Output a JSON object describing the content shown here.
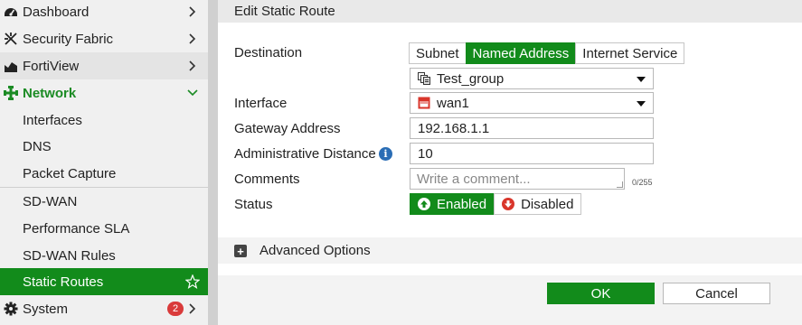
{
  "sidebar": {
    "items": [
      {
        "label": "Dashboard",
        "icon": "dashboard-icon"
      },
      {
        "label": "Security Fabric",
        "icon": "security-fabric-icon"
      },
      {
        "label": "FortiView",
        "icon": "fortiview-icon"
      },
      {
        "label": "Network",
        "icon": "network-icon"
      },
      {
        "label": "Interfaces"
      },
      {
        "label": "DNS"
      },
      {
        "label": "Packet Capture"
      },
      {
        "label": "SD-WAN"
      },
      {
        "label": "Performance SLA"
      },
      {
        "label": "SD-WAN Rules"
      },
      {
        "label": "Static Routes"
      },
      {
        "label": "System",
        "icon": "gear-icon",
        "badge": "2"
      }
    ]
  },
  "dialog": {
    "title": "Edit Static Route",
    "destination": {
      "label": "Destination",
      "options": [
        "Subnet",
        "Named Address",
        "Internet Service"
      ],
      "selected": "Named Address",
      "address_value": "Test_group"
    },
    "interface": {
      "label": "Interface",
      "value": "wan1"
    },
    "gateway": {
      "label": "Gateway Address",
      "value": "192.168.1.1"
    },
    "distance": {
      "label": "Administrative Distance",
      "value": "10"
    },
    "comments": {
      "label": "Comments",
      "placeholder": "Write a comment...",
      "counter": "0/255"
    },
    "status": {
      "label": "Status",
      "enabled": "Enabled",
      "disabled": "Disabled",
      "value": "Enabled"
    },
    "advanced": {
      "label": "Advanced Options"
    },
    "buttons": {
      "ok": "OK",
      "cancel": "Cancel"
    }
  },
  "colors": {
    "accent": "#128b1b",
    "danger": "#d9362b",
    "badge": "#d93a3a",
    "info": "#2a6db5"
  }
}
